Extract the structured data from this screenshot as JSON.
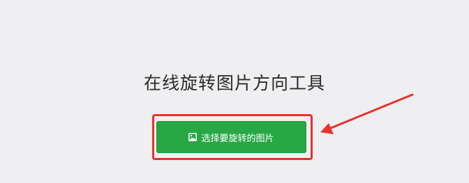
{
  "page": {
    "title": "在线旋转图片方向工具"
  },
  "upload": {
    "button_label": "选择要旋转的图片",
    "icon": "image-icon"
  },
  "annotation": {
    "highlight_color": "#e8322c",
    "arrow_color": "#e8322c"
  },
  "colors": {
    "background": "#efeff1",
    "button": "#28a745",
    "button_text": "#ffffff",
    "title_text": "#2b2b2b"
  }
}
